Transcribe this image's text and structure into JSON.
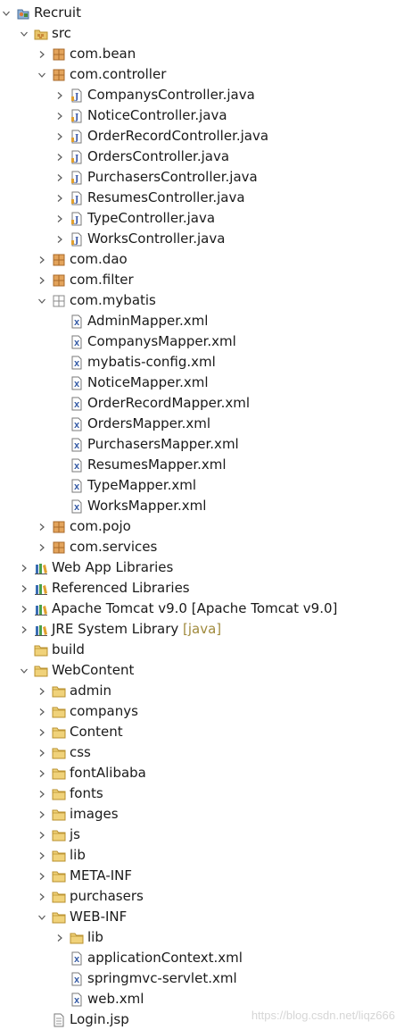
{
  "tree": [
    {
      "label": "Recruit",
      "depth": 0,
      "toggle": "expanded",
      "icon": "project-icon"
    },
    {
      "label": "src",
      "depth": 1,
      "toggle": "expanded",
      "icon": "source-folder-icon"
    },
    {
      "label": "com.bean",
      "depth": 2,
      "toggle": "collapsed",
      "icon": "package-icon"
    },
    {
      "label": "com.controller",
      "depth": 2,
      "toggle": "expanded",
      "icon": "package-icon"
    },
    {
      "label": "CompanysController.java",
      "depth": 3,
      "toggle": "collapsed",
      "icon": "java-file-icon"
    },
    {
      "label": "NoticeController.java",
      "depth": 3,
      "toggle": "collapsed",
      "icon": "java-file-icon"
    },
    {
      "label": "OrderRecordController.java",
      "depth": 3,
      "toggle": "collapsed",
      "icon": "java-file-icon"
    },
    {
      "label": "OrdersController.java",
      "depth": 3,
      "toggle": "collapsed",
      "icon": "java-file-icon"
    },
    {
      "label": "PurchasersController.java",
      "depth": 3,
      "toggle": "collapsed",
      "icon": "java-file-icon"
    },
    {
      "label": "ResumesController.java",
      "depth": 3,
      "toggle": "collapsed",
      "icon": "java-file-icon"
    },
    {
      "label": "TypeController.java",
      "depth": 3,
      "toggle": "collapsed",
      "icon": "java-file-icon"
    },
    {
      "label": "WorksController.java",
      "depth": 3,
      "toggle": "collapsed",
      "icon": "java-file-icon"
    },
    {
      "label": "com.dao",
      "depth": 2,
      "toggle": "collapsed",
      "icon": "package-icon"
    },
    {
      "label": "com.filter",
      "depth": 2,
      "toggle": "collapsed",
      "icon": "package-icon"
    },
    {
      "label": "com.mybatis",
      "depth": 2,
      "toggle": "expanded",
      "icon": "package-empty-icon"
    },
    {
      "label": "AdminMapper.xml",
      "depth": 3,
      "toggle": "none",
      "icon": "xml-file-icon"
    },
    {
      "label": "CompanysMapper.xml",
      "depth": 3,
      "toggle": "none",
      "icon": "xml-file-icon"
    },
    {
      "label": "mybatis-config.xml",
      "depth": 3,
      "toggle": "none",
      "icon": "xml-file-icon"
    },
    {
      "label": "NoticeMapper.xml",
      "depth": 3,
      "toggle": "none",
      "icon": "xml-file-icon"
    },
    {
      "label": "OrderRecordMapper.xml",
      "depth": 3,
      "toggle": "none",
      "icon": "xml-file-icon"
    },
    {
      "label": "OrdersMapper.xml",
      "depth": 3,
      "toggle": "none",
      "icon": "xml-file-icon"
    },
    {
      "label": "PurchasersMapper.xml",
      "depth": 3,
      "toggle": "none",
      "icon": "xml-file-icon"
    },
    {
      "label": "ResumesMapper.xml",
      "depth": 3,
      "toggle": "none",
      "icon": "xml-file-icon"
    },
    {
      "label": "TypeMapper.xml",
      "depth": 3,
      "toggle": "none",
      "icon": "xml-file-icon"
    },
    {
      "label": "WorksMapper.xml",
      "depth": 3,
      "toggle": "none",
      "icon": "xml-file-icon"
    },
    {
      "label": "com.pojo",
      "depth": 2,
      "toggle": "collapsed",
      "icon": "package-icon"
    },
    {
      "label": "com.services",
      "depth": 2,
      "toggle": "collapsed",
      "icon": "package-icon"
    },
    {
      "label": "Web App Libraries",
      "depth": 1,
      "toggle": "collapsed",
      "icon": "library-icon"
    },
    {
      "label": "Referenced Libraries",
      "depth": 1,
      "toggle": "collapsed",
      "icon": "library-icon"
    },
    {
      "label": "Apache Tomcat v9.0 [Apache Tomcat v9.0]",
      "depth": 1,
      "toggle": "collapsed",
      "icon": "library-icon"
    },
    {
      "label": "JRE System Library",
      "decor": "[java]",
      "depth": 1,
      "toggle": "collapsed",
      "icon": "library-icon"
    },
    {
      "label": "build",
      "depth": 1,
      "toggle": "none",
      "icon": "folder-icon"
    },
    {
      "label": "WebContent",
      "depth": 1,
      "toggle": "expanded",
      "icon": "folder-icon"
    },
    {
      "label": "admin",
      "depth": 2,
      "toggle": "collapsed",
      "icon": "folder-icon"
    },
    {
      "label": "companys",
      "depth": 2,
      "toggle": "collapsed",
      "icon": "folder-icon"
    },
    {
      "label": "Content",
      "depth": 2,
      "toggle": "collapsed",
      "icon": "folder-icon"
    },
    {
      "label": "css",
      "depth": 2,
      "toggle": "collapsed",
      "icon": "folder-icon"
    },
    {
      "label": "fontAlibaba",
      "depth": 2,
      "toggle": "collapsed",
      "icon": "folder-icon"
    },
    {
      "label": "fonts",
      "depth": 2,
      "toggle": "collapsed",
      "icon": "folder-icon"
    },
    {
      "label": "images",
      "depth": 2,
      "toggle": "collapsed",
      "icon": "folder-icon"
    },
    {
      "label": "js",
      "depth": 2,
      "toggle": "collapsed",
      "icon": "folder-icon"
    },
    {
      "label": "lib",
      "depth": 2,
      "toggle": "collapsed",
      "icon": "folder-icon"
    },
    {
      "label": "META-INF",
      "depth": 2,
      "toggle": "collapsed",
      "icon": "folder-icon"
    },
    {
      "label": "purchasers",
      "depth": 2,
      "toggle": "collapsed",
      "icon": "folder-icon"
    },
    {
      "label": "WEB-INF",
      "depth": 2,
      "toggle": "expanded",
      "icon": "folder-icon"
    },
    {
      "label": "lib",
      "depth": 3,
      "toggle": "collapsed",
      "icon": "folder-icon"
    },
    {
      "label": "applicationContext.xml",
      "depth": 3,
      "toggle": "none",
      "icon": "xml-file-icon"
    },
    {
      "label": "springmvc-servlet.xml",
      "depth": 3,
      "toggle": "none",
      "icon": "xml-file-icon"
    },
    {
      "label": "web.xml",
      "depth": 3,
      "toggle": "none",
      "icon": "xml-file-icon"
    },
    {
      "label": "Login.jsp",
      "depth": 2,
      "toggle": "none",
      "icon": "jsp-file-icon"
    }
  ],
  "watermark": "https://blog.csdn.net/liqz666",
  "colors": {
    "arrow": "#5a5a5a",
    "folder": "#e8c46a",
    "folder_stroke": "#b8902e",
    "package": "#c8883a",
    "java_j": "#3c5aa8",
    "xml_x": "#3a5fa8",
    "library": "#3b6db3",
    "decor_text": "#a08a3c"
  }
}
